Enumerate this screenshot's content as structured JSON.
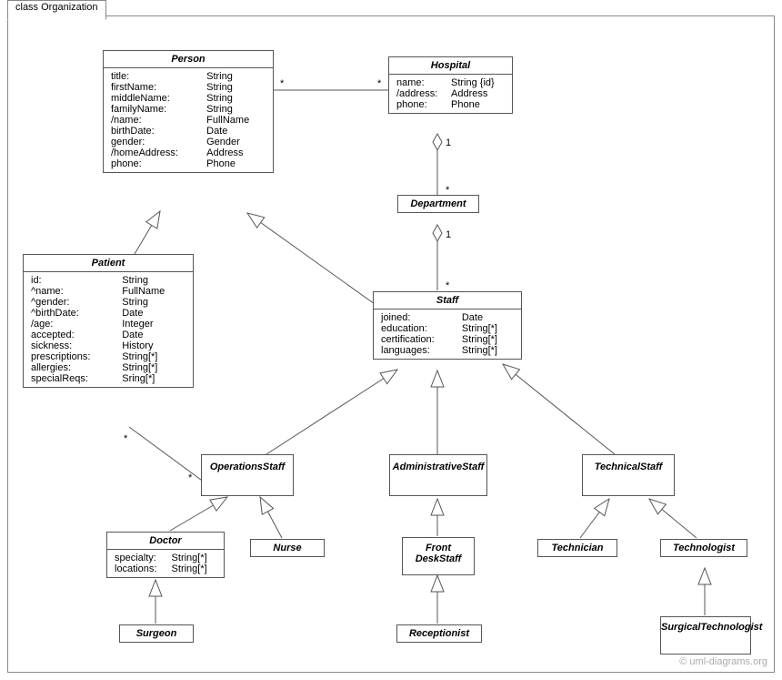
{
  "frameLabel": "class Organization",
  "watermark": "© uml-diagrams.org",
  "classes": {
    "person": {
      "name": "Person",
      "attrs": [
        [
          "title:",
          "String"
        ],
        [
          "firstName:",
          "String"
        ],
        [
          "middleName:",
          "String"
        ],
        [
          "familyName:",
          "String"
        ],
        [
          "/name:",
          "FullName"
        ],
        [
          "birthDate:",
          "Date"
        ],
        [
          "gender:",
          "Gender"
        ],
        [
          "/homeAddress:",
          "Address"
        ],
        [
          "phone:",
          "Phone"
        ]
      ]
    },
    "hospital": {
      "name": "Hospital",
      "attrs": [
        [
          "name:",
          "String {id}"
        ],
        [
          "/address:",
          "Address"
        ],
        [
          "phone:",
          "Phone"
        ]
      ]
    },
    "department": {
      "name": "Department"
    },
    "patient": {
      "name": "Patient",
      "attrs": [
        [
          "id:",
          "String"
        ],
        [
          "^name:",
          "FullName"
        ],
        [
          "^gender:",
          "String"
        ],
        [
          "^birthDate:",
          "Date"
        ],
        [
          "/age:",
          "Integer"
        ],
        [
          "accepted:",
          "Date"
        ],
        [
          "sickness:",
          "History"
        ],
        [
          "prescriptions:",
          "String[*]"
        ],
        [
          "allergies:",
          "String[*]"
        ],
        [
          "specialReqs:",
          "Sring[*]"
        ]
      ]
    },
    "staff": {
      "name": "Staff",
      "attrs": [
        [
          "joined:",
          "Date"
        ],
        [
          "education:",
          "String[*]"
        ],
        [
          "certification:",
          "String[*]"
        ],
        [
          "languages:",
          "String[*]"
        ]
      ]
    },
    "opsStaff": {
      "name": "OperationsStaff"
    },
    "adminStaff": {
      "name": "AdministrativeStaff"
    },
    "techStaff": {
      "name": "TechnicalStaff"
    },
    "doctor": {
      "name": "Doctor",
      "attrs": [
        [
          "specialty:",
          "String[*]"
        ],
        [
          "locations:",
          "String[*]"
        ]
      ]
    },
    "nurse": {
      "name": "Nurse"
    },
    "frontDesk": {
      "name": "Front DeskStaff"
    },
    "receptionist": {
      "name": "Receptionist"
    },
    "technician": {
      "name": "Technician"
    },
    "technologist": {
      "name": "Technologist"
    },
    "surgTech": {
      "name": "SurgicalTechnologist"
    }
  },
  "mults": {
    "star": "*",
    "one": "1"
  }
}
